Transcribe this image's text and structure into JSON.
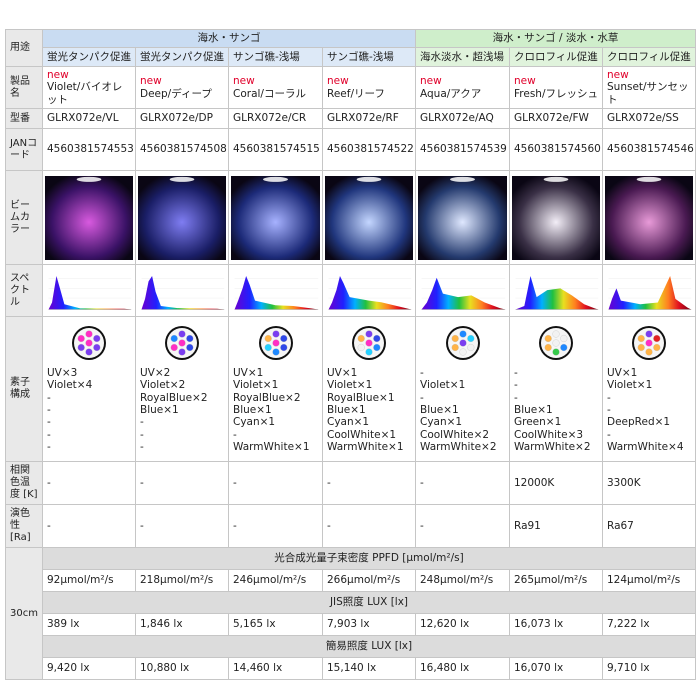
{
  "row_labels": {
    "use": "用途",
    "product": "製品名",
    "model": "型番",
    "jan": "JANコード",
    "beam": "ビームカラー",
    "spectrum": "スペクトル",
    "composition": "素子構成",
    "cct": "相関色温度 [K]",
    "cri": "演色性 [Ra]",
    "distance": "30cm"
  },
  "groups": {
    "marine": "海水・サンゴ",
    "mixed": "海水・サンゴ / 淡水・水草"
  },
  "new_label": "new",
  "products": [
    {
      "use": "蛍光タンパク促進",
      "name": "Violet/バイオレット",
      "model": "GLRX072e/VL",
      "jan": "4560381574553",
      "comp": [
        "UV×3",
        "Violet×4",
        "-",
        "-",
        "-",
        "-",
        "-"
      ],
      "cct": "-",
      "cri": "-",
      "ppfd": "92μmol/m²/s",
      "jis": "389 lx",
      "lux": "9,420 lx",
      "chips": [
        "#ff2ec4",
        "#ff2ec4",
        "#7a3df0",
        "#7a3df0",
        "#7a3df0",
        "#7a3df0",
        "#ff2ec4"
      ],
      "beam_center": "#d85adf",
      "beam_edge": "#3a1266"
    },
    {
      "use": "蛍光タンパク促進",
      "name": "Deep/ディープ",
      "model": "GLRX072e/DP",
      "jan": "4560381574508",
      "comp": [
        "UV×2",
        "Violet×2",
        "RoyalBlue×2",
        "Blue×1",
        "-",
        "-",
        "-"
      ],
      "cct": "-",
      "cri": "-",
      "ppfd": "218μmol/m²/s",
      "jis": "1,846 lx",
      "lux": "10,880 lx",
      "chips": [
        "#ff2ec4",
        "#7a3df0",
        "#2f48e8",
        "#2f48e8",
        "#7a3df0",
        "#ff2ec4",
        "#1e88ff"
      ],
      "beam_center": "#7f7df2",
      "beam_edge": "#1a1e66"
    },
    {
      "use": "サンゴ礁-浅場",
      "name": "Coral/コーラル",
      "model": "GLRX072e/CR",
      "jan": "4560381574515",
      "comp": [
        "UV×1",
        "Violet×1",
        "RoyalBlue×2",
        "Blue×1",
        "Cyan×1",
        "-",
        "WarmWhite×1"
      ],
      "cct": "-",
      "cri": "-",
      "ppfd": "246μmol/m²/s",
      "jis": "5,165 lx",
      "lux": "14,460 lx",
      "chips": [
        "#ff2ec4",
        "#7a3df0",
        "#2f48e8",
        "#2f48e8",
        "#1e88ff",
        "#25d0ff",
        "#ffb347"
      ],
      "beam_center": "#a7b2ff",
      "beam_edge": "#1c2a78"
    },
    {
      "use": "サンゴ礁-浅場",
      "name": "Reef/リーフ",
      "model": "GLRX072e/RF",
      "jan": "4560381574522",
      "comp": [
        "UV×1",
        "Violet×1",
        "RoyalBlue×1",
        "Blue×1",
        "Cyan×1",
        "CoolWhite×1",
        "WarmWhite×1"
      ],
      "cct": "-",
      "cri": "-",
      "ppfd": "266μmol/m²/s",
      "jis": "7,903 lx",
      "lux": "15,140 lx",
      "chips": [
        "#ff2ec4",
        "#7a3df0",
        "#2f48e8",
        "#1e88ff",
        "#25d0ff",
        "#f2f2f2",
        "#ffb347"
      ],
      "beam_center": "#c4d6ff",
      "beam_edge": "#20367d"
    },
    {
      "use": "海水淡水・超浅場",
      "name": "Aqua/アクア",
      "model": "GLRX072e/AQ",
      "jan": "4560381574539",
      "comp": [
        "-",
        "Violet×1",
        "-",
        "Blue×1",
        "Cyan×1",
        "CoolWhite×2",
        "WarmWhite×2"
      ],
      "cct": "-",
      "cri": "-",
      "ppfd": "248μmol/m²/s",
      "jis": "12,620 lx",
      "lux": "16,480 lx",
      "chips": [
        "#7a3df0",
        "#1e88ff",
        "#25d0ff",
        "#f2f2f2",
        "#f2f2f2",
        "#ffb347",
        "#ffb347"
      ],
      "beam_center": "#dfe8ff",
      "beam_edge": "#243a6e"
    },
    {
      "use": "クロロフィル促進",
      "name": "Fresh/フレッシュ",
      "model": "GLRX072e/FW",
      "jan": "4560381574560",
      "comp": [
        "-",
        "-",
        "-",
        "Blue×1",
        "Green×1",
        "CoolWhite×3",
        "WarmWhite×2"
      ],
      "cct": "12000K",
      "cri": "Ra91",
      "ppfd": "265μmol/m²/s",
      "jis": "16,073 lx",
      "lux": "16,070 lx",
      "chips": [
        "#f2f2f2",
        "#f2f2f2",
        "#f2f2f2",
        "#1e88ff",
        "#35c94a",
        "#ffb347",
        "#ffb347"
      ],
      "beam_center": "#f3eef7",
      "beam_edge": "#3a3046"
    },
    {
      "use": "クロロフィル促進",
      "name": "Sunset/サンセット",
      "model": "GLRX072e/SS",
      "jan": "4560381574546",
      "comp": [
        "UV×1",
        "Violet×1",
        "-",
        "-",
        "DeepRed×1",
        "-",
        "WarmWhite×4"
      ],
      "cct": "3300K",
      "cri": "Ra67",
      "ppfd": "124μmol/m²/s",
      "jis": "7,222 lx",
      "lux": "9,710 lx",
      "chips": [
        "#ff2ec4",
        "#7a3df0",
        "#e02020",
        "#ffb347",
        "#ffb347",
        "#ffb347",
        "#ffb347"
      ],
      "beam_center": "#e89ad8",
      "beam_edge": "#4a1a52"
    }
  ],
  "sections": {
    "ppfd": "光合成光量子束密度 PPFD [μmol/m²/s]",
    "jis": "JIS照度 LUX [lx]",
    "lux": "簡易照度 LUX [lx]"
  }
}
